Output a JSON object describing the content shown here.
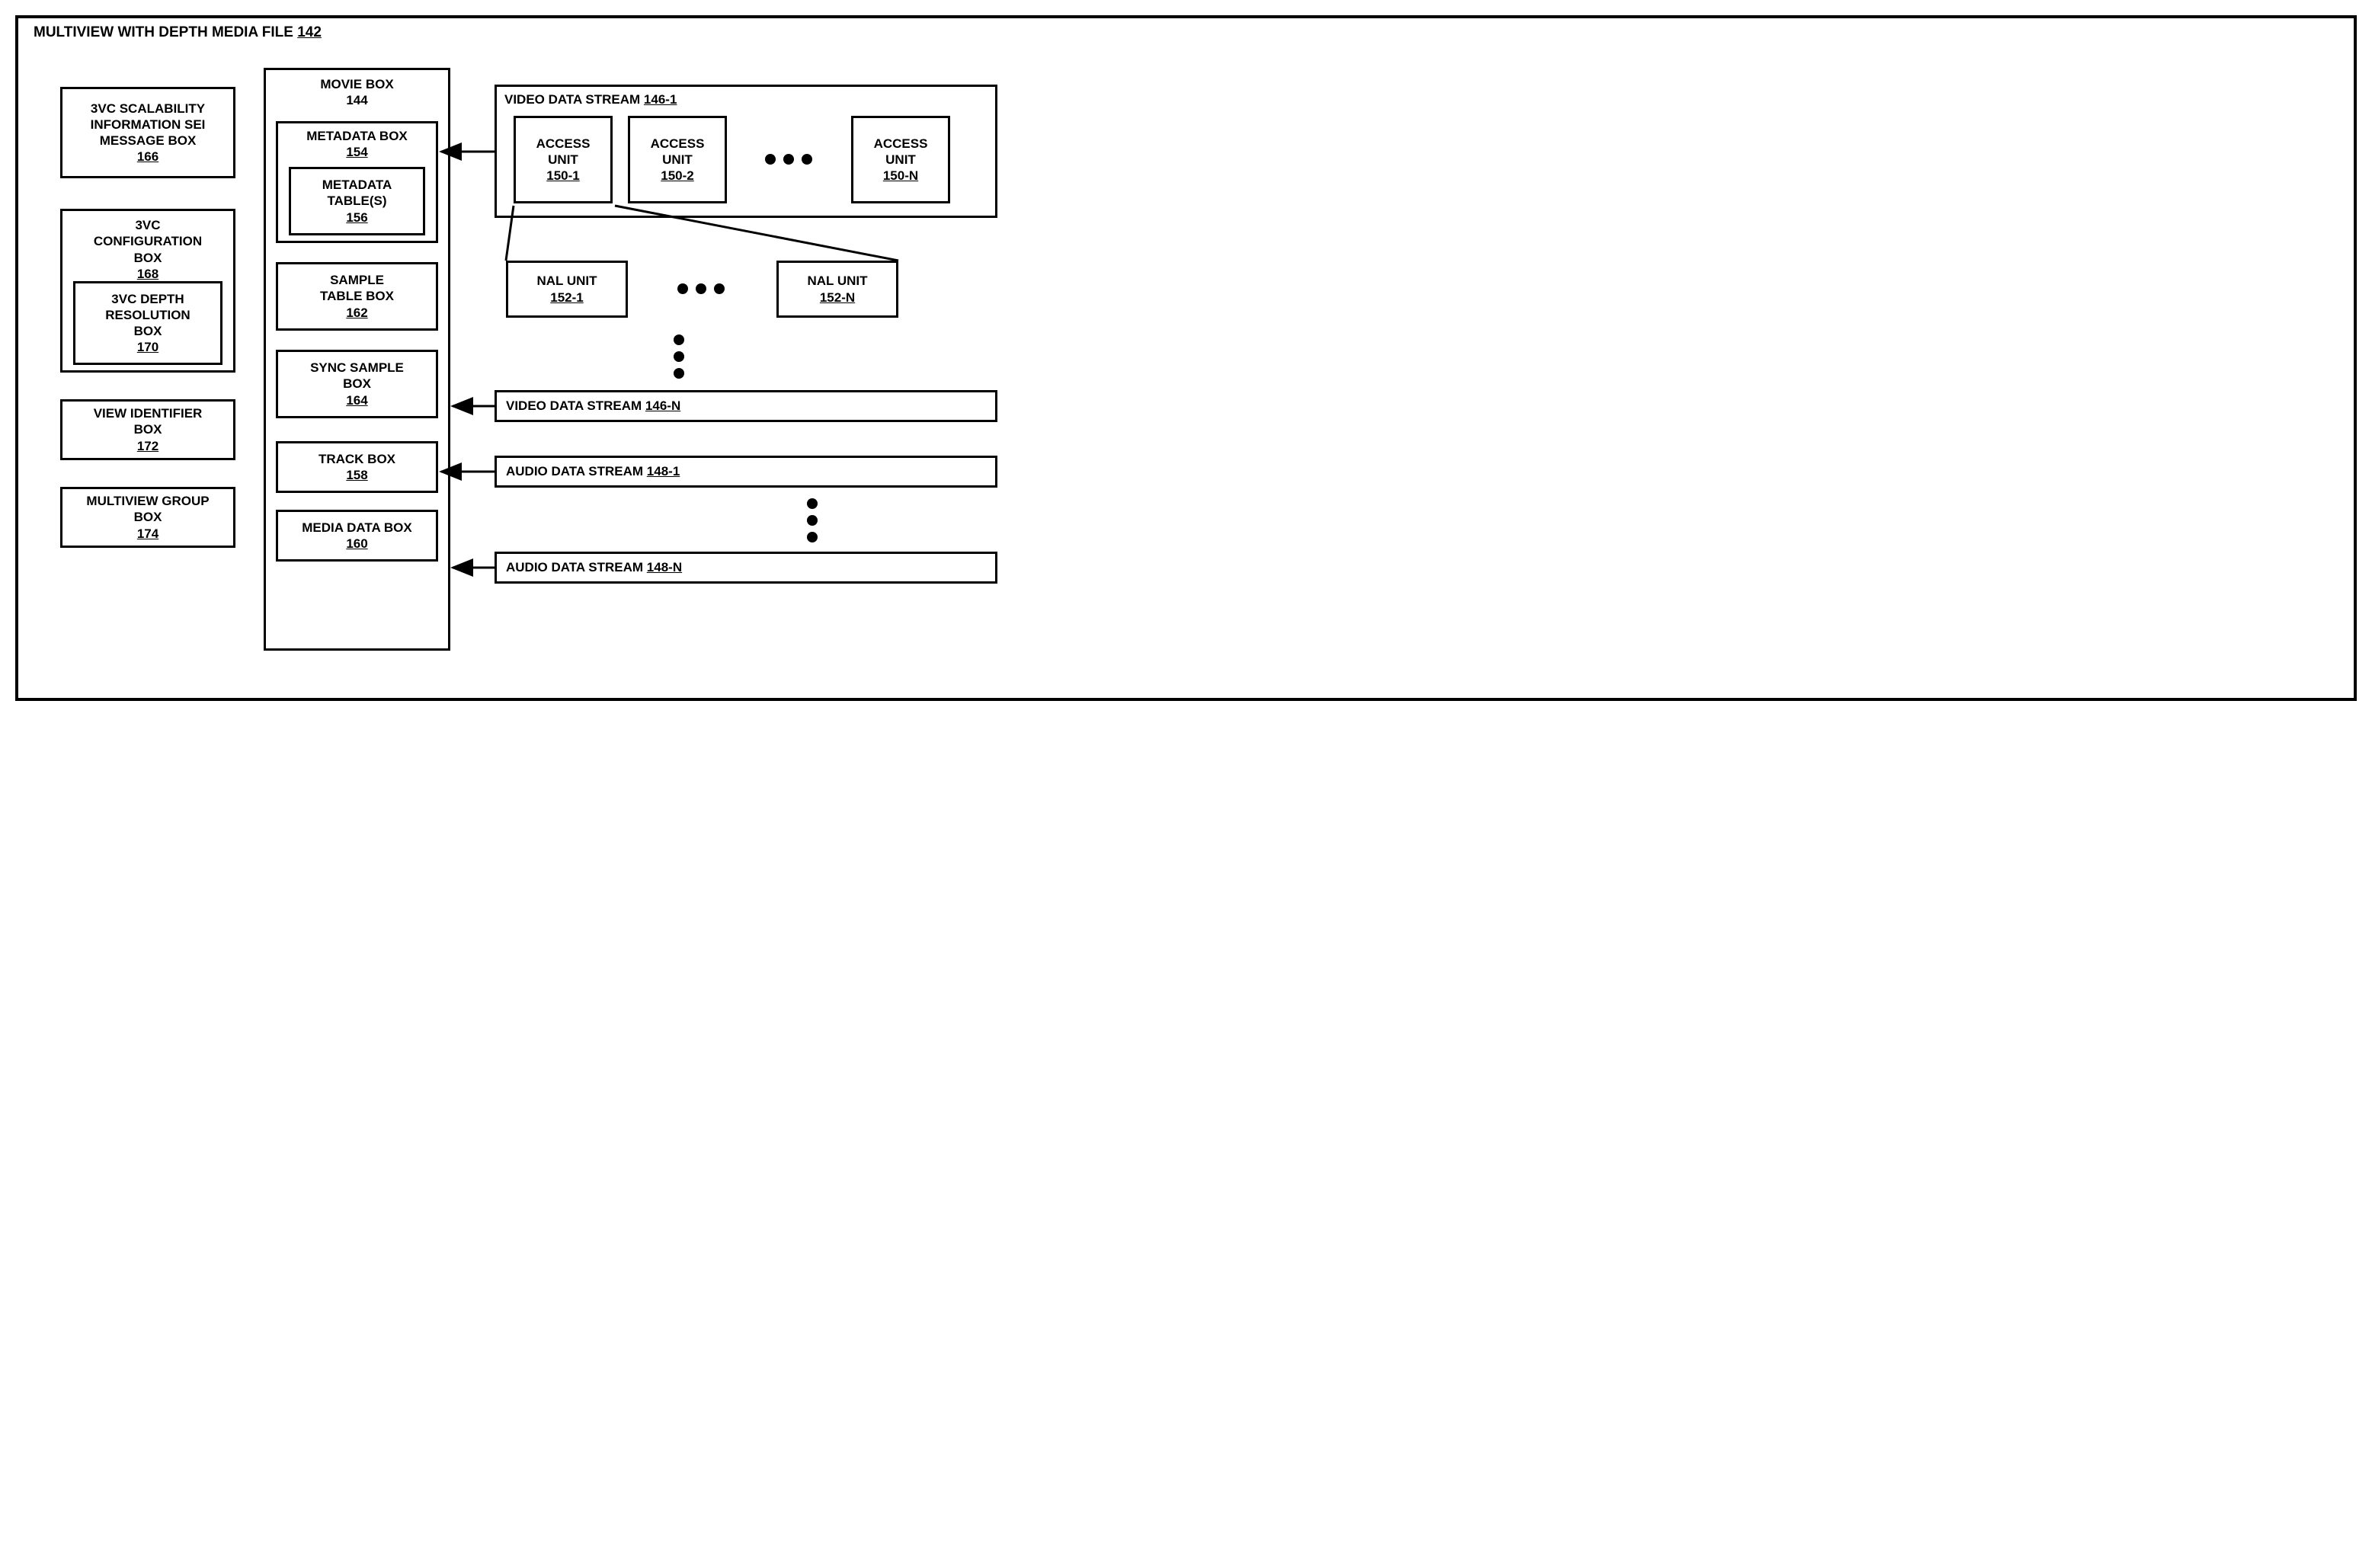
{
  "file": {
    "title": "MULTIVIEW WITH DEPTH MEDIA FILE",
    "ref": "142"
  },
  "left": {
    "sei": {
      "l1": "3VC SCALABILITY",
      "l2": "INFORMATION SEI",
      "l3": "MESSAGE BOX",
      "ref": "166"
    },
    "config": {
      "l1": "3VC",
      "l2": "CONFIGURATION",
      "l3": "BOX",
      "ref": "168"
    },
    "depth": {
      "l1": "3VC DEPTH",
      "l2": "RESOLUTION",
      "l3": "BOX",
      "ref": "170"
    },
    "viewid": {
      "l1": "VIEW IDENTIFIER",
      "l2": "BOX",
      "ref": "172"
    },
    "mvgroup": {
      "l1": "MULTIVIEW GROUP",
      "l2": "BOX",
      "ref": "174"
    }
  },
  "movie": {
    "title": "MOVIE BOX",
    "ref": "144",
    "metabox": {
      "title": "METADATA BOX",
      "ref": "154"
    },
    "metatable": {
      "l1": "METADATA",
      "l2": "TABLE(S)",
      "ref": "156"
    },
    "sample": {
      "l1": "SAMPLE",
      "l2": "TABLE BOX",
      "ref": "162"
    },
    "sync": {
      "l1": "SYNC SAMPLE",
      "l2": "BOX",
      "ref": "164"
    },
    "track": {
      "title": "TRACK BOX",
      "ref": "158"
    },
    "mediadata": {
      "title": "MEDIA DATA BOX",
      "ref": "160"
    }
  },
  "right": {
    "vds1": {
      "title": "VIDEO DATA STREAM",
      "ref": "146-1"
    },
    "au1": {
      "l1": "ACCESS",
      "l2": "UNIT",
      "ref": "150-1"
    },
    "au2": {
      "l1": "ACCESS",
      "l2": "UNIT",
      "ref": "150-2"
    },
    "aun": {
      "l1": "ACCESS",
      "l2": "UNIT",
      "ref": "150-N"
    },
    "nal1": {
      "title": "NAL UNIT",
      "ref": "152-1"
    },
    "naln": {
      "title": "NAL UNIT",
      "ref": "152-N"
    },
    "vdsn": {
      "title": "VIDEO DATA STREAM",
      "ref": "146-N"
    },
    "ads1": {
      "title": "AUDIO DATA STREAM",
      "ref": "148-1"
    },
    "adsn": {
      "title": "AUDIO DATA STREAM",
      "ref": "148-N"
    }
  }
}
